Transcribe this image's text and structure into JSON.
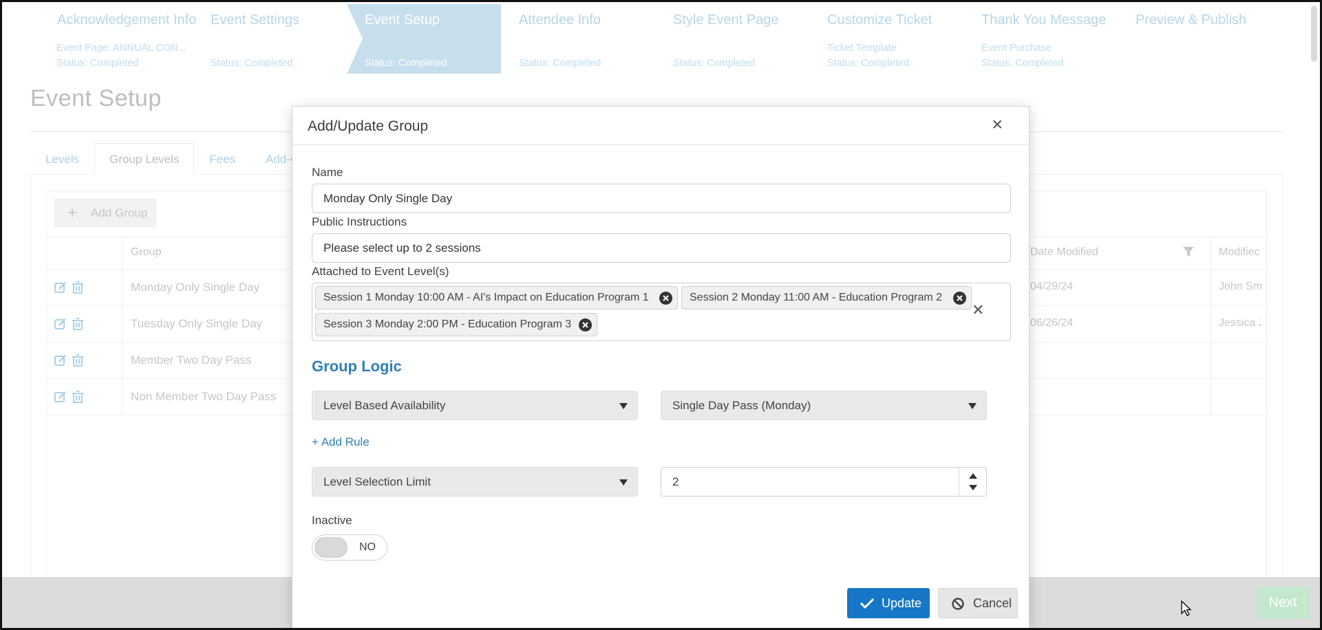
{
  "wizard": {
    "steps": [
      {
        "title": "Acknowledgement Info",
        "line1": "Event Page: ANNUAL CON...",
        "line2": "Status: Completed"
      },
      {
        "title": "Event Settings",
        "line1": "",
        "line2": "Status: Completed"
      },
      {
        "title": "Event Setup",
        "line1": "",
        "line2": "Status: Completed"
      },
      {
        "title": "Attendee Info",
        "line1": "",
        "line2": "Status: Completed"
      },
      {
        "title": "Style Event Page",
        "line1": "",
        "line2": "Status: Completed"
      },
      {
        "title": "Customize Ticket",
        "line1": "Ticket Template",
        "line2": "Status: Completed"
      },
      {
        "title": "Thank You Message",
        "line1": "Event Purchase",
        "line2": "Status: Completed"
      },
      {
        "title": "Preview & Publish",
        "line1": "",
        "line2": ""
      }
    ],
    "active_index": 2
  },
  "page": {
    "title": "Event Setup",
    "tabs": [
      "Levels",
      "Group Levels",
      "Fees",
      "Add-O"
    ],
    "active_tab": "Group Levels",
    "add_group_label": "Add Group",
    "grid": {
      "headers": {
        "group": "Group",
        "date_modified": "Date Modified",
        "modified_by": "Modifiec"
      },
      "rows": [
        {
          "name": "Monday Only Single Day",
          "date": "04/29/24",
          "user": "John Sm"
        },
        {
          "name": "Tuesday Only Single Day",
          "date": "06/26/24",
          "user": "Jessica J"
        },
        {
          "name": "Member Two Day Pass",
          "date": "",
          "user": ""
        },
        {
          "name": "Non Member Two Day Pass",
          "date": "",
          "user": ""
        }
      ]
    },
    "next_label": "Next"
  },
  "modal": {
    "title": "Add/Update Group",
    "name_label": "Name",
    "name_value": "Monday Only Single Day",
    "instructions_label": "Public Instructions",
    "instructions_value": "Please select up to 2 sessions",
    "attached_label": "Attached to Event Level(s)",
    "attached_levels": [
      "Session 1 Monday 10:00 AM - AI's Impact on Education Program 1",
      "Session 2 Monday 11:00 AM - Education Program 2",
      "Session 3 Monday 2:00 PM - Education Program 3"
    ],
    "group_logic_title": "Group Logic",
    "rule1_type": "Level Based Availability",
    "rule1_value": "Single Day Pass (Monday)",
    "add_rule_label": "+ Add Rule",
    "limit_type": "Level Selection Limit",
    "limit_value": "2",
    "inactive_label": "Inactive",
    "inactive_state": "NO",
    "update_label": "Update",
    "cancel_label": "Cancel"
  },
  "colors": {
    "accent": "#2e7fb8",
    "primary_button": "#1677c8",
    "step_active": "#a9cde3",
    "next_button": "#a4dcb2"
  }
}
